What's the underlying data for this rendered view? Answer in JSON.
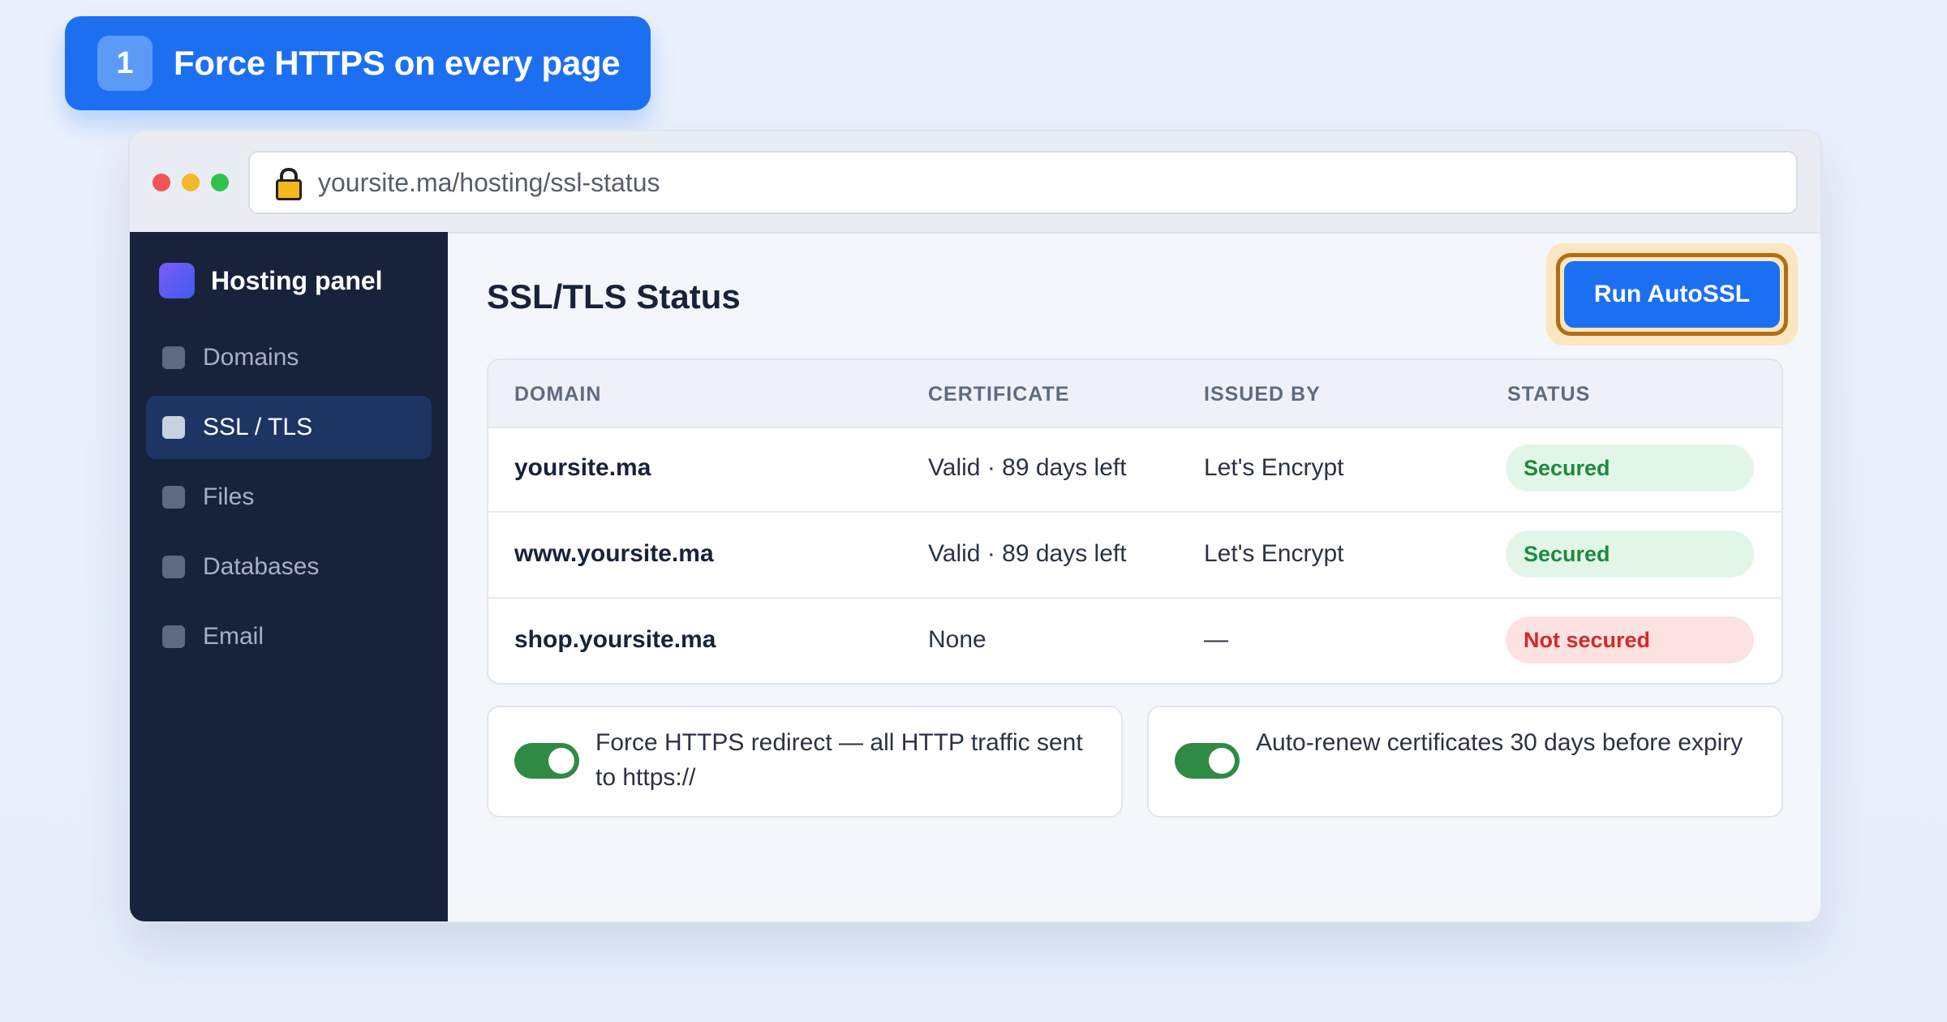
{
  "step": {
    "number": "1",
    "title": "Force HTTPS on every page"
  },
  "browser": {
    "url": "yoursite.ma/hosting/ssl-status"
  },
  "sidebar": {
    "brand": "Hosting panel",
    "items": [
      {
        "label": "Domains",
        "active": false
      },
      {
        "label": "SSL / TLS",
        "active": true
      },
      {
        "label": "Files",
        "active": false
      },
      {
        "label": "Databases",
        "active": false
      },
      {
        "label": "Email",
        "active": false
      }
    ]
  },
  "main": {
    "title": "SSL/TLS Status",
    "run_button": "Run AutoSSL",
    "table": {
      "headers": [
        "DOMAIN",
        "CERTIFICATE",
        "ISSUED BY",
        "STATUS"
      ],
      "rows": [
        {
          "domain": "yoursite.ma",
          "certificate": "Valid · 89 days left",
          "issued_by": "Let's Encrypt",
          "status": "Secured",
          "status_type": "ok"
        },
        {
          "domain": "www.yoursite.ma",
          "certificate": "Valid · 89 days left",
          "issued_by": "Let's Encrypt",
          "status": "Secured",
          "status_type": "ok"
        },
        {
          "domain": "shop.yoursite.ma",
          "certificate": "None",
          "issued_by": "—",
          "status": "Not secured",
          "status_type": "bad"
        }
      ]
    },
    "toggles": [
      {
        "label": "Force HTTPS redirect — all HTTP traffic sent to https://",
        "enabled": true
      },
      {
        "label": "Auto-renew certificates 30 days before expiry",
        "enabled": true
      }
    ]
  },
  "colors": {
    "accent": "#1d6ff2",
    "sidebar_bg": "#17223b",
    "highlight_ring": "#b26d14",
    "secured": "#1e8a3c",
    "not_secured": "#d22a2a",
    "toggle_on": "#2f8a44"
  }
}
